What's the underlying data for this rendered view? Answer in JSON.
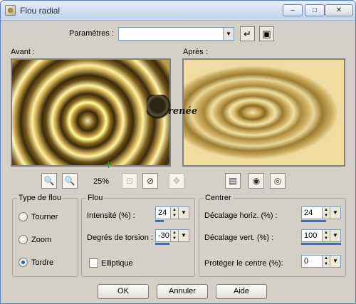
{
  "window": {
    "title": "Flou radial",
    "minimize": "–",
    "maximize": "□",
    "close": "✕"
  },
  "params": {
    "label": "Paramètres :",
    "value": ""
  },
  "preview": {
    "before_label": "Avant :",
    "after_label": "Après :",
    "watermark": "renée",
    "zoom": "25%"
  },
  "type_group": {
    "title": "Type de flou",
    "options": [
      "Tourner",
      "Zoom",
      "Tordre"
    ],
    "selected": "Tordre"
  },
  "flou_group": {
    "title": "Flou",
    "intensite_label": "Intensité (%) :",
    "intensite_value": "24",
    "intensite_fraction": 0.24,
    "torsion_label": "Degrés de torsion :",
    "torsion_value": "-30",
    "torsion_fraction": 0.42,
    "elliptique_label": "Elliptique",
    "elliptique_checked": false
  },
  "centrer_group": {
    "title": "Centrer",
    "horiz_label": "Décalage horiz. (%) :",
    "horiz_value": "24",
    "horiz_fraction": 0.62,
    "vert_label": "Décalage vert. (%) :",
    "vert_value": "100",
    "vert_fraction": 1.0,
    "proteger_label": "Protéger le centre (%):",
    "proteger_value": "0"
  },
  "buttons": {
    "ok": "OK",
    "annuler": "Annuler",
    "aide": "Aide"
  },
  "colors": {
    "accent": "#2f6fd0",
    "dialog_bg": "#d4d0c8",
    "title_bar": "#c3d4ea"
  }
}
